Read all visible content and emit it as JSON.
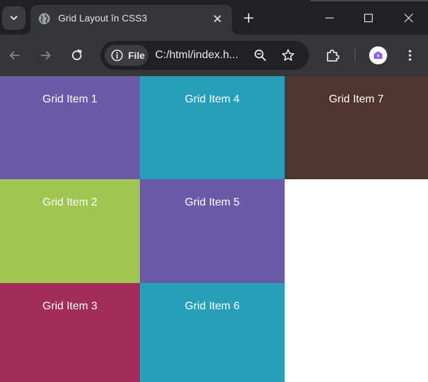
{
  "browser": {
    "tab": {
      "title": "Grid Layout în CSS3"
    },
    "omnibox": {
      "chip_label": "File",
      "url": "C:/html/index.h..."
    }
  },
  "icons": {
    "tab_search": "chevron-down-icon",
    "favicon": "globe-icon",
    "tab_close": "close-icon",
    "new_tab": "plus-icon",
    "minimize": "minimize-icon",
    "maximize": "maximize-icon",
    "close_window": "close-icon",
    "back": "arrow-left-icon",
    "forward": "arrow-right-icon",
    "reload": "reload-icon",
    "site_info": "info-icon",
    "zoom": "zoom-out-icon",
    "bookmark": "star-icon",
    "extensions": "puzzle-icon",
    "profile": "avatar-icon",
    "menu": "more-vertical-icon"
  },
  "grid": {
    "items": [
      {
        "label": "Grid Item 1",
        "color": "#6a5aa8"
      },
      {
        "label": "Grid Item 2",
        "color": "#9fc650"
      },
      {
        "label": "Grid Item 3",
        "color": "#a22d5a"
      },
      {
        "label": "Grid Item 4",
        "color": "#279fbb"
      },
      {
        "label": "Grid Item 5",
        "color": "#6a5aa8"
      },
      {
        "label": "Grid Item 6",
        "color": "#279fbb"
      },
      {
        "label": "Grid Item 7",
        "color": "#50342f"
      }
    ]
  },
  "colors": {
    "titlebar": "#1f2125",
    "toolbar": "#35363a",
    "omnibox": "#202124",
    "page_background": "#ffffff"
  }
}
